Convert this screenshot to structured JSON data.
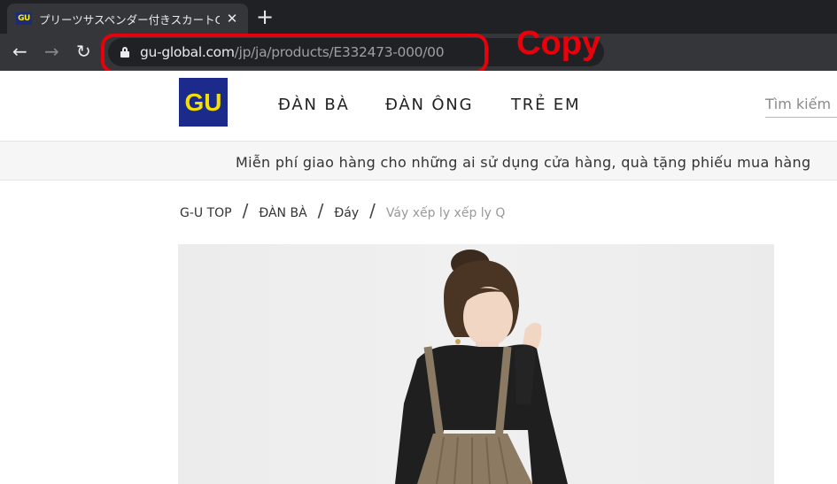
{
  "browser": {
    "tab": {
      "favicon_text": "GU",
      "title": "プリーツサスペンダー付きスカートQ | GU",
      "close": "✕"
    },
    "new_tab": "+",
    "nav": {
      "back": "←",
      "forward": "→",
      "reload": "↻"
    },
    "url": {
      "host": "gu-global.com",
      "path": "/jp/ja/products/E332473-000/00"
    }
  },
  "annotation": {
    "label": "Copy",
    "color": "#e8000b"
  },
  "site": {
    "logo": "GU",
    "brand_color": "#1c2a8c",
    "logo_text_color": "#f2e100",
    "nav": [
      "ĐÀN BÀ",
      "ĐÀN ÔNG",
      "TRẺ EM"
    ],
    "search_placeholder": "Tìm kiếm",
    "promo": "Miễn phí giao hàng cho những ai sử dụng cửa hàng, quà tặng phiếu mua hàng",
    "breadcrumb": [
      "G-U TOP",
      "ĐÀN BÀ",
      "Đáy",
      "Váy xếp ly xếp ly Q"
    ]
  }
}
